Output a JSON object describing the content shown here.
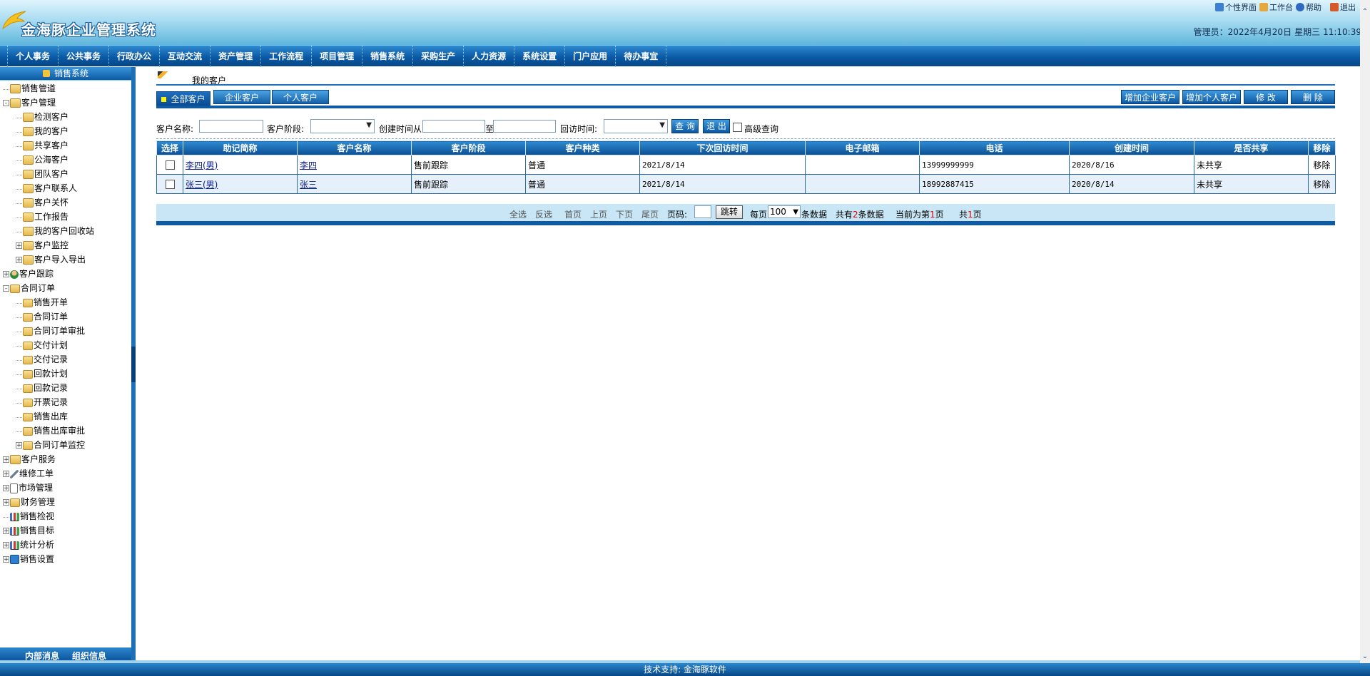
{
  "app": {
    "title": "金海豚企业管理系统"
  },
  "toplinks": [
    {
      "label": "个性界面",
      "color": "#3d7fd1"
    },
    {
      "label": "工作台",
      "color": "#e6a73c"
    },
    {
      "label": "帮助",
      "color": "#2f68c2"
    },
    {
      "label": "退出",
      "color": "#d55b2b"
    }
  ],
  "user": {
    "role": "管理员：",
    "date": "2022年4月20日",
    "weekday": "星期三",
    "time": "11:10:39"
  },
  "nav": [
    "个人事务",
    "公共事务",
    "行政办公",
    "互动交流",
    "资产管理",
    "工作流程",
    "项目管理",
    "销售系统",
    "采购生产",
    "人力资源",
    "系统设置",
    "门户应用",
    "待办事宜"
  ],
  "sidebar": {
    "title": "销售系统",
    "tree": [
      {
        "label": "销售管道",
        "level": 0,
        "toggle": "",
        "icon": "group"
      },
      {
        "label": "客户管理",
        "level": 0,
        "toggle": "-",
        "icon": "group"
      },
      {
        "label": "检测客户",
        "level": 1,
        "toggle": "",
        "icon": "group"
      },
      {
        "label": "我的客户",
        "level": 1,
        "toggle": "",
        "icon": "group"
      },
      {
        "label": "共享客户",
        "level": 1,
        "toggle": "",
        "icon": "group"
      },
      {
        "label": "公海客户",
        "level": 1,
        "toggle": "",
        "icon": "group"
      },
      {
        "label": "团队客户",
        "level": 1,
        "toggle": "",
        "icon": "group"
      },
      {
        "label": "客户联系人",
        "level": 1,
        "toggle": "",
        "icon": "group"
      },
      {
        "label": "客户关怀",
        "level": 1,
        "toggle": "",
        "icon": "group"
      },
      {
        "label": "工作报告",
        "level": 1,
        "toggle": "",
        "icon": "group"
      },
      {
        "label": "我的客户回收站",
        "level": 1,
        "toggle": "",
        "icon": "group"
      },
      {
        "label": "客户监控",
        "level": 1,
        "toggle": "+",
        "icon": "group"
      },
      {
        "label": "客户导入导出",
        "level": 1,
        "toggle": "+",
        "icon": "group"
      },
      {
        "label": "客户跟踪",
        "level": 0,
        "toggle": "+",
        "icon": "person"
      },
      {
        "label": "合同订单",
        "level": 0,
        "toggle": "-",
        "icon": "folder"
      },
      {
        "label": "销售开单",
        "level": 1,
        "toggle": "",
        "icon": "folder"
      },
      {
        "label": "合同订单",
        "level": 1,
        "toggle": "",
        "icon": "folder"
      },
      {
        "label": "合同订单审批",
        "level": 1,
        "toggle": "",
        "icon": "folder"
      },
      {
        "label": "交付计划",
        "level": 1,
        "toggle": "",
        "icon": "folder"
      },
      {
        "label": "交付记录",
        "level": 1,
        "toggle": "",
        "icon": "folder"
      },
      {
        "label": "回款计划",
        "level": 1,
        "toggle": "",
        "icon": "folder"
      },
      {
        "label": "回款记录",
        "level": 1,
        "toggle": "",
        "icon": "folder"
      },
      {
        "label": "开票记录",
        "level": 1,
        "toggle": "",
        "icon": "folder"
      },
      {
        "label": "销售出库",
        "level": 1,
        "toggle": "",
        "icon": "folder"
      },
      {
        "label": "销售出库审批",
        "level": 1,
        "toggle": "",
        "icon": "folder"
      },
      {
        "label": "合同订单监控",
        "level": 1,
        "toggle": "+",
        "icon": "folder"
      },
      {
        "label": "客户服务",
        "level": 0,
        "toggle": "+",
        "icon": "group"
      },
      {
        "label": "维修工单",
        "level": 0,
        "toggle": "+",
        "icon": "wrench"
      },
      {
        "label": "市场管理",
        "level": 0,
        "toggle": "+",
        "icon": "doc"
      },
      {
        "label": "财务管理",
        "level": 0,
        "toggle": "+",
        "icon": "folder"
      },
      {
        "label": "销售检视",
        "level": 0,
        "toggle": "",
        "icon": "chart"
      },
      {
        "label": "销售目标",
        "level": 0,
        "toggle": "+",
        "icon": "chart"
      },
      {
        "label": "统计分析",
        "level": 0,
        "toggle": "+",
        "icon": "chart"
      },
      {
        "label": "销售设置",
        "level": 0,
        "toggle": "+",
        "icon": "setting"
      }
    ],
    "footer": [
      "内部消息",
      "组织信息"
    ]
  },
  "main": {
    "page_title": "我的客户",
    "tabs": [
      "全部客户",
      "企业客户",
      "个人客户"
    ],
    "actions": [
      "增加企业客户",
      "增加个人客户",
      "修 改",
      "删 除"
    ],
    "search": {
      "name_label": "客户名称:",
      "stage_label": "客户阶段:",
      "created_label": "创建时间从",
      "to_label": "至",
      "visit_label": "回访时间:",
      "query_btn": "查 询",
      "exit_btn": "退 出",
      "advanced_label": "高级查询"
    },
    "table": {
      "headers": [
        "选择",
        "助记简称",
        "客户名称",
        "客户阶段",
        "客户种类",
        "下次回访时间",
        "电子邮箱",
        "电话",
        "创建时间",
        "是否共享",
        "移除"
      ],
      "rows": [
        {
          "short": "李四(男)",
          "name": "李四",
          "stage": "售前跟踪",
          "kind": "普通",
          "next_visit": "2021/8/14",
          "email": "",
          "phone": "13999999999",
          "created": "2020/8/16",
          "shared": "未共享",
          "remove": "移除"
        },
        {
          "short": "张三(男)",
          "name": "张三",
          "stage": "售前跟踪",
          "kind": "普通",
          "next_visit": "2021/8/14",
          "email": "",
          "phone": "18992887415",
          "created": "2020/8/14",
          "shared": "未共享",
          "remove": "移除"
        }
      ]
    },
    "pager": {
      "select_all": "全选",
      "invert": "反选",
      "first": "首页",
      "prev": "上页",
      "next": "下页",
      "last": "尾页",
      "page_label": "页码:",
      "go_btn": "跳转",
      "per_page_label": "每页",
      "per_page_value": "100",
      "per_page_suffix": "条数据",
      "total_prefix": "共有",
      "total_count": "2",
      "total_suffix": "条数据",
      "current_prefix": "当前为第",
      "current_page": "1",
      "current_suffix": "页",
      "pages_prefix": "共",
      "pages_count": "1",
      "pages_suffix": "页"
    }
  },
  "footer": {
    "text": "技术支持: 金海豚软件"
  }
}
